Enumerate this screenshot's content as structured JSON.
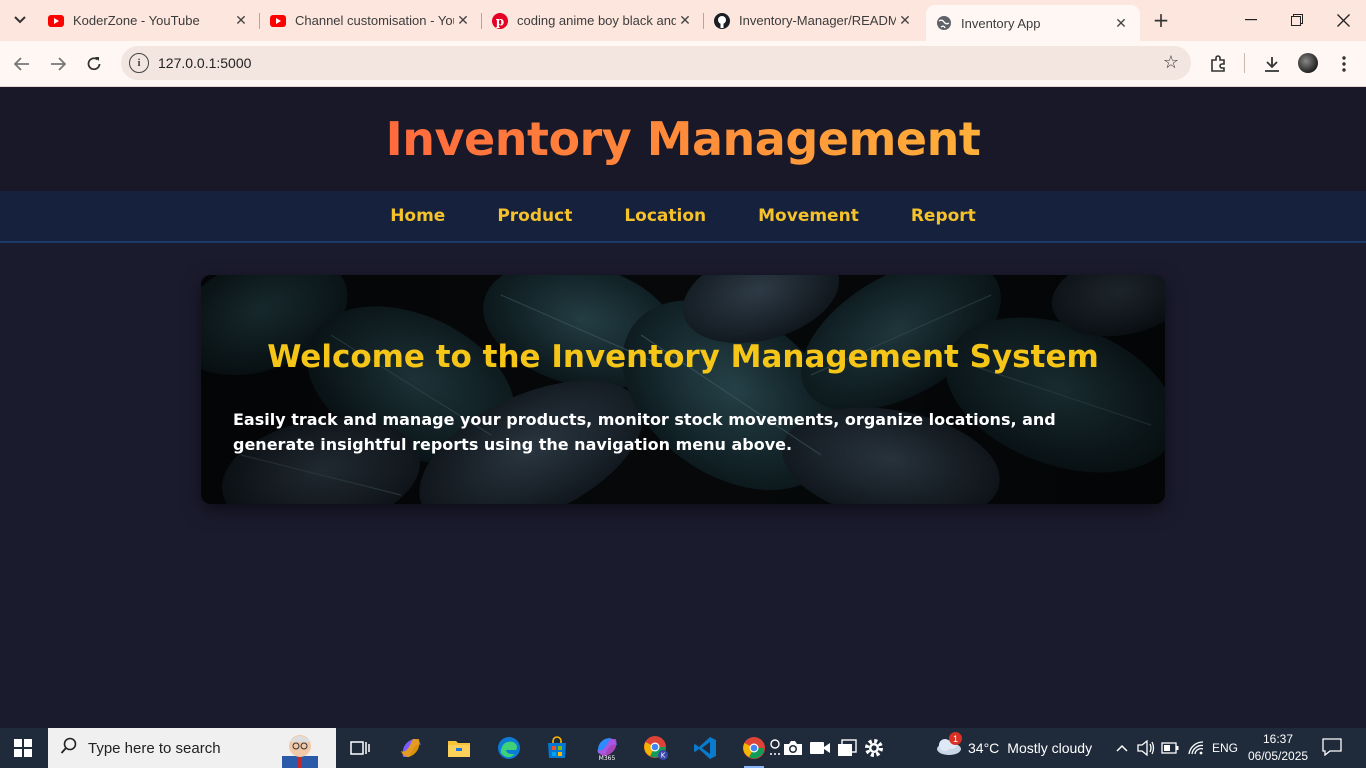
{
  "browser": {
    "tabs": [
      {
        "title": "KoderZone - YouTube",
        "icon": "youtube-icon"
      },
      {
        "title": "Channel customisation - You",
        "icon": "youtube-icon"
      },
      {
        "title": "coding anime boy black and",
        "icon": "pinterest-icon"
      },
      {
        "title": "Inventory-Manager/READM",
        "icon": "github-icon"
      },
      {
        "title": "Inventory App",
        "icon": "globe-icon",
        "active": true
      }
    ],
    "url": "127.0.0.1:5000"
  },
  "site": {
    "title": "Inventory Management",
    "nav": [
      "Home",
      "Product",
      "Location",
      "Movement",
      "Report"
    ]
  },
  "hero": {
    "heading": "Welcome to the Inventory Management System",
    "body": "Easily track and manage your products, monitor stock movements, organize locations, and generate insightful reports using the navigation menu above."
  },
  "taskbar": {
    "search_placeholder": "Type here to search",
    "weather": {
      "temp": "34°C",
      "condition": "Mostly cloudy",
      "badge": "1"
    },
    "language": "ENG",
    "time": "16:37",
    "date": "06/05/2025"
  },
  "colors": {
    "page_bg": "#1b1b2e",
    "nav_bg": "#16213e",
    "accent_yellow": "#f5c22a",
    "title_gradient_start": "#ff6a3d",
    "title_gradient_end": "#ffb03a",
    "tab_strip": "#fde6dd"
  }
}
